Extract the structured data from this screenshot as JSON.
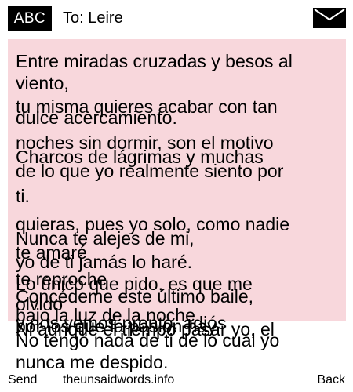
{
  "header": {
    "input_mode": "ABC",
    "recipient_label": "To: Leire",
    "icon": "envelope-icon"
  },
  "message": {
    "lines": [
      "Entre miradas cruzadas y besos al",
      "viento,",
      "tu misma quieres acabar con tan",
      "dulce acercamiento.",
      "noches sin dormir, son el motivo",
      "Charcos de lágrimas y muchas",
      "de lo que yo realmente siento por",
      "ti.",
      "quieras, pues yo solo, como nadie",
      "Nunca te alejes de mi,",
      "te amaré",
      "yo de ti jamás lo haré.",
      "te reproche",
      "Lo único que pido, es que me",
      "Concédeme este último baile,",
      "olvido",
      "bajo la luz de la noche",
      "y nos vemos pronto, adiós",
      "por los que la pasión hay",
      "Ni aunque el tiempo pasar yo, el",
      "No tengo nada de ti de lo cual yo",
      "nunca me despido."
    ]
  },
  "footer": {
    "left_softkey": "Send",
    "site": "theunsaidwords.info",
    "right_softkey": "Back"
  },
  "colors": {
    "message_background": "#f8d7dc",
    "badge_background": "#000000",
    "badge_text": "#ffffff"
  }
}
